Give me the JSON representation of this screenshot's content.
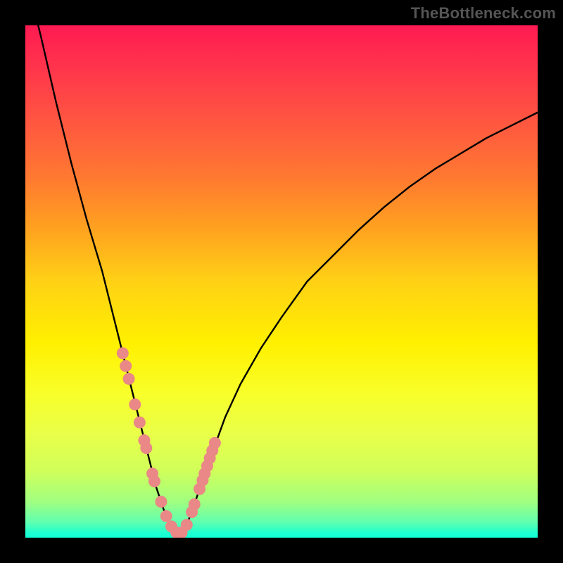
{
  "watermark": "TheBottleneck.com",
  "colors": {
    "curve": "#000000",
    "marker_fill": "#e98886",
    "marker_stroke": "#e98886",
    "background_outer": "#000000"
  },
  "chart_data": {
    "type": "line",
    "title": "",
    "xlabel": "",
    "ylabel": "",
    "xlim": [
      0,
      100
    ],
    "ylim": [
      0,
      100
    ],
    "series": [
      {
        "name": "curve",
        "x": [
          0,
          3,
          6,
          9,
          12,
          15,
          17,
          19,
          21,
          22.5,
          24,
          25.5,
          27,
          28.5,
          29.5,
          30.5,
          31.5,
          33,
          35,
          37,
          39,
          42,
          46,
          50,
          55,
          60,
          65,
          70,
          75,
          80,
          85,
          90,
          95,
          100
        ],
        "y": [
          110,
          98,
          85,
          73,
          62,
          52,
          44,
          36,
          28,
          22,
          16,
          10,
          5.5,
          2.2,
          1,
          1,
          2.5,
          6.5,
          12.5,
          18,
          23.5,
          30,
          37,
          43,
          50,
          55,
          60,
          64.5,
          68.5,
          72,
          75,
          78,
          80.5,
          83
        ]
      }
    ],
    "markers": {
      "name": "data-points",
      "x": [
        19.0,
        19.6,
        20.2,
        21.4,
        22.3,
        23.2,
        23.6,
        24.8,
        25.2,
        26.5,
        27.5,
        28.5,
        29.5,
        30.5,
        31.5,
        32.5,
        33.0,
        34.0,
        34.6,
        35.0,
        35.5,
        36.0,
        36.5,
        37.0
      ],
      "y": [
        36.0,
        33.5,
        31.0,
        26.0,
        22.5,
        19.0,
        17.5,
        12.5,
        11.0,
        7.0,
        4.2,
        2.2,
        1.0,
        1.0,
        2.5,
        5.0,
        6.5,
        9.5,
        11.2,
        12.5,
        14.0,
        15.5,
        17.0,
        18.5
      ]
    }
  }
}
